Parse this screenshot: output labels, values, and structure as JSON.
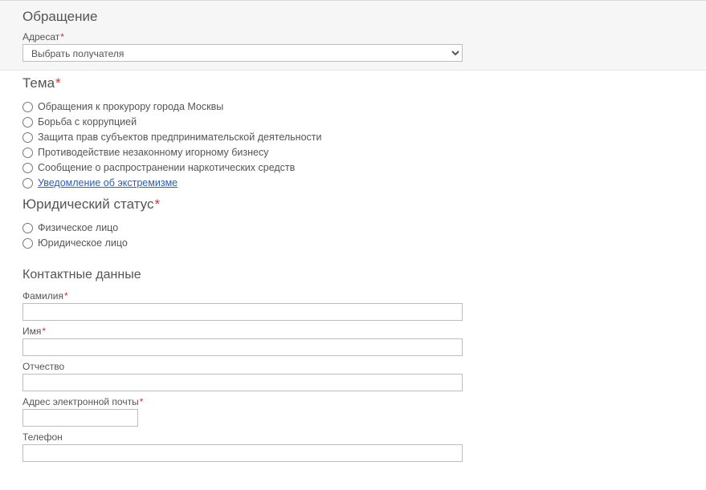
{
  "appeal": {
    "heading": "Обращение",
    "recipient": {
      "label": "Адресат",
      "required": "*",
      "placeholder": "Выбрать получателя"
    }
  },
  "topic": {
    "heading": "Тема",
    "required": "*",
    "options": [
      "Обращения к прокурору города Москвы",
      "Борьба с коррупцией",
      "Защита прав субъектов предпринимательской деятельности",
      "Противодействие незаконному игорному бизнесу",
      "Сообщение о распространении наркотических средств",
      "Уведомление об экстремизме"
    ]
  },
  "legal_status": {
    "heading": "Юридический статус",
    "required": "*",
    "options": [
      "Физическое лицо",
      "Юридическое лицо"
    ]
  },
  "contact": {
    "heading": "Контактные данные",
    "lastname": {
      "label": "Фамилия",
      "required": "*"
    },
    "firstname": {
      "label": "Имя",
      "required": "*"
    },
    "middlename": {
      "label": "Отчество",
      "required": ""
    },
    "email": {
      "label": "Адрес электронной почты",
      "required": "*"
    },
    "phone": {
      "label": "Телефон",
      "required": ""
    }
  }
}
